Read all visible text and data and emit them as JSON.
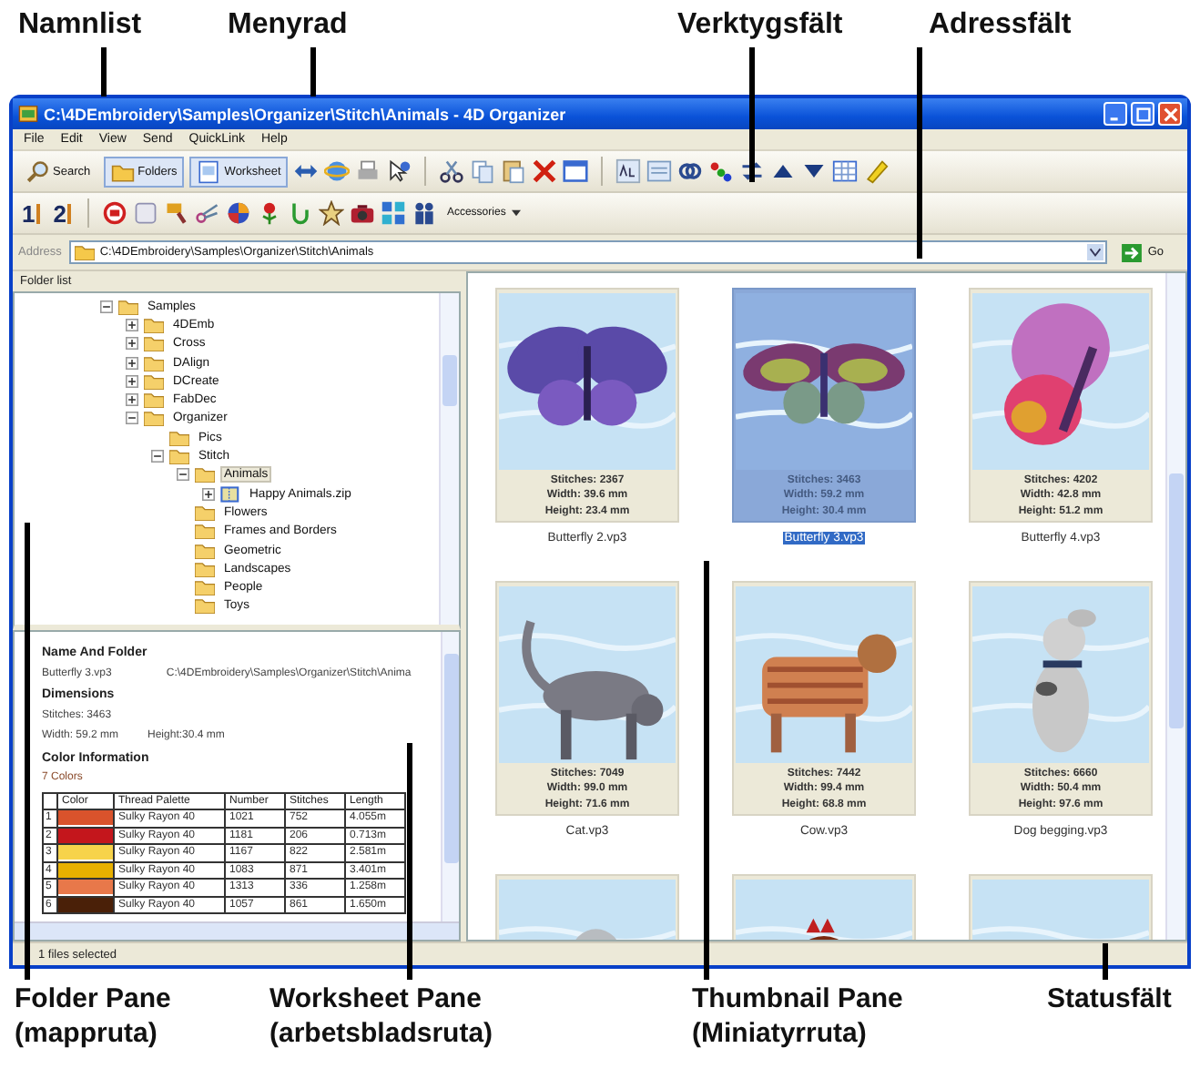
{
  "callouts_top": [
    "Namnlist",
    "Menyrad",
    "Verktygsfält",
    "Adressfält"
  ],
  "window": {
    "title": "C:\\4DEmbroidery\\Samples\\Organizer\\Stitch\\Animals - 4D Organizer"
  },
  "menu": [
    "File",
    "Edit",
    "View",
    "Send",
    "QuickLink",
    "Help"
  ],
  "toolbar_1": {
    "buttons": [
      {
        "label": "Search",
        "selected": false
      },
      {
        "label": "Folders",
        "selected": true
      },
      {
        "label": "Worksheet",
        "selected": true
      }
    ]
  },
  "toolbar_2": {
    "sort_buttons": [
      "1",
      "2"
    ],
    "dropdown": "Accessories"
  },
  "address": {
    "label": "Address",
    "value": "C:\\4DEmbroidery\\Samples\\Organizer\\Stitch\\Animals",
    "go": "Go"
  },
  "folder_pane": {
    "header": "Folder list",
    "tree": [
      {
        "label": "Samples",
        "expanded": true,
        "selected": false,
        "children": [
          {
            "label": "4DEmb",
            "expanded": false,
            "selected": false
          },
          {
            "label": "Cross",
            "expanded": false,
            "selected": false
          },
          {
            "label": "DAlign",
            "expanded": false,
            "selected": false
          },
          {
            "label": "DCreate",
            "expanded": false,
            "selected": false
          },
          {
            "label": "FabDec",
            "expanded": false,
            "selected": false
          },
          {
            "label": "Organizer",
            "expanded": true,
            "selected": false,
            "children": [
              {
                "label": "Pics",
                "selected": false
              },
              {
                "label": "Stitch",
                "expanded": true,
                "selected": false,
                "children": [
                  {
                    "label": "Animals",
                    "expanded": true,
                    "selected": true,
                    "children": [
                      {
                        "label": "Happy Animals.zip",
                        "kind": "archive",
                        "expanded": false,
                        "selected": false
                      }
                    ]
                  },
                  {
                    "label": "Flowers",
                    "selected": false
                  },
                  {
                    "label": "Frames and Borders",
                    "selected": false
                  },
                  {
                    "label": "Geometric",
                    "selected": false
                  },
                  {
                    "label": "Landscapes",
                    "selected": false
                  },
                  {
                    "label": "People",
                    "selected": false
                  },
                  {
                    "label": "Toys",
                    "selected": false
                  }
                ]
              }
            ]
          }
        ]
      }
    ]
  },
  "worksheet": {
    "name_heading": "Name And Folder",
    "file": "Butterfly 3.vp3",
    "path": "C:\\4DEmbroidery\\Samples\\Organizer\\Stitch\\Anima",
    "dimensions_heading": "Dimensions",
    "stitches": "Stitches: 3463",
    "width": "Width: 59.2 mm",
    "height": "Height:30.4 mm",
    "color_heading": "Color Information",
    "color_count": "7 Colors",
    "table": {
      "columns": [
        "Color",
        "Thread Palette",
        "Number",
        "Stitches",
        "Length"
      ],
      "rows": [
        {
          "index": "1",
          "color": "#d9532c",
          "palette": "Sulky Rayon 40",
          "number": "1021",
          "stitches": "752",
          "length": "4.055m"
        },
        {
          "index": "2",
          "color": "#c4161c",
          "palette": "Sulky Rayon 40",
          "number": "1181",
          "stitches": "206",
          "length": "0.713m"
        },
        {
          "index": "3",
          "color": "#f7d34a",
          "palette": "Sulky Rayon 40",
          "number": "1167",
          "stitches": "822",
          "length": "2.581m"
        },
        {
          "index": "4",
          "color": "#e8b000",
          "palette": "Sulky Rayon 40",
          "number": "1083",
          "stitches": "871",
          "length": "3.401m"
        },
        {
          "index": "5",
          "color": "#e8784a",
          "palette": "Sulky Rayon 40",
          "number": "1313",
          "stitches": "336",
          "length": "1.258m"
        },
        {
          "index": "6",
          "color": "#4a2008",
          "palette": "Sulky Rayon 40",
          "number": "1057",
          "stitches": "861",
          "length": "1.650m"
        }
      ]
    }
  },
  "thumbnails": [
    {
      "kind": "item",
      "stitches": "Stitches: 2367",
      "width": "Width: 39.6 mm",
      "height": "Height: 23.4 mm",
      "name": "Butterfly 2.vp3",
      "selected": false
    },
    {
      "kind": "item",
      "stitches": "Stitches: 3463",
      "width": "Width: 59.2 mm",
      "height": "Height: 30.4 mm",
      "name": "Butterfly 3.vp3",
      "selected": true
    },
    {
      "kind": "item",
      "stitches": "Stitches: 4202",
      "width": "Width: 42.8 mm",
      "height": "Height: 51.2 mm",
      "name": "Butterfly 4.vp3",
      "selected": false
    },
    {
      "kind": "item",
      "stitches": "Stitches: 7049",
      "width": "Width: 99.0 mm",
      "height": "Height: 71.6 mm",
      "name": "Cat.vp3",
      "selected": false
    },
    {
      "kind": "item",
      "stitches": "Stitches: 7442",
      "width": "Width: 99.4 mm",
      "height": "Height: 68.8 mm",
      "name": "Cow.vp3",
      "selected": false
    },
    {
      "kind": "item",
      "stitches": "Stitches: 6660",
      "width": "Width: 50.4 mm",
      "height": "Height: 97.6 mm",
      "name": "Dog begging.vp3",
      "selected": false
    },
    {
      "kind": "picture",
      "selected": false
    },
    {
      "kind": "picture",
      "selected": false
    },
    {
      "kind": "picture",
      "selected": false
    }
  ],
  "status_bar": "1 files selected",
  "callouts_bottom": [
    {
      "title": "Folder Pane",
      "subtitle": "(mappruta)"
    },
    {
      "title": "Worksheet Pane",
      "subtitle": "(arbetsbladsruta)"
    },
    {
      "title": "Thumbnail Pane",
      "subtitle": "(Miniatyrruta)"
    },
    {
      "title": "Statusfält"
    }
  ]
}
